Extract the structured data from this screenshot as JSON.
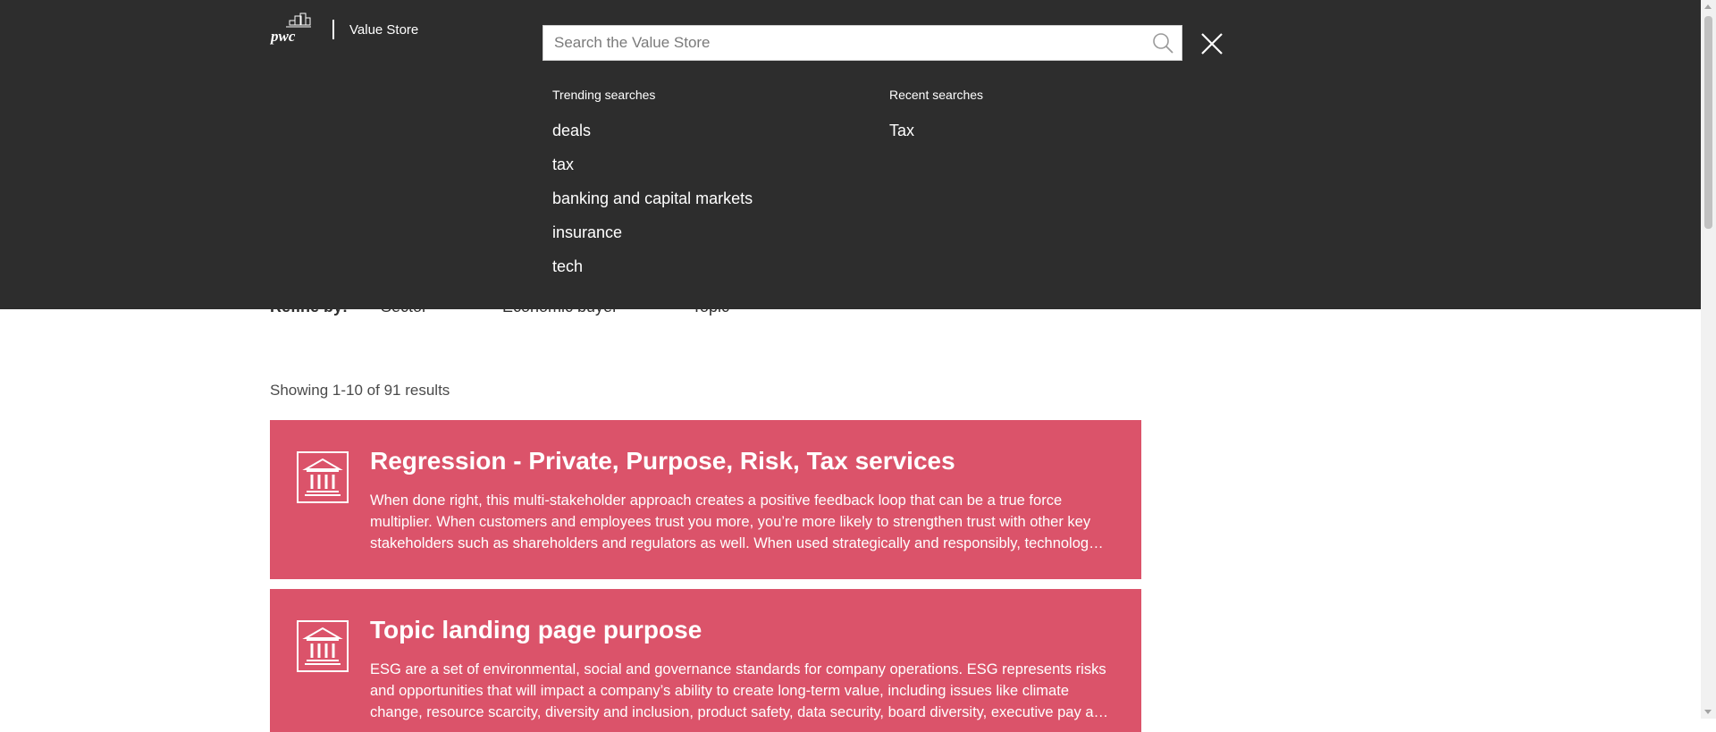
{
  "header": {
    "brand_name": "Value Store",
    "logo_text": "pwc",
    "search_placeholder": "Search the Value Store"
  },
  "trending": {
    "heading": "Trending searches",
    "items": [
      "deals",
      "tax",
      "banking and capital markets",
      "insurance",
      "tech"
    ]
  },
  "recent": {
    "heading": "Recent searches",
    "items": [
      "Tax"
    ]
  },
  "refine": {
    "label": "Refine by:",
    "options": [
      "Sector",
      "Economic buyer",
      "Topic"
    ]
  },
  "results": {
    "count_text": "Showing 1-10 of 91 results",
    "cards": [
      {
        "title": "Regression - Private, Purpose, Risk, Tax services",
        "description": "When done right, this multi-stakeholder approach creates a positive feedback loop that can be a true force multiplier. When customers and employees trust you more, you’re more likely to strengthen trust with other key stakeholders such as shareholders and regulators as well. When used strategically and responsibly, technology can also be a powerful enabler of trust.",
        "icon": "institution-icon"
      },
      {
        "title": "Topic landing page purpose",
        "description": "ESG are a set of environmental, social and governance standards for company operations. ESG represents risks and opportunities that will impact a company’s ability to create long-term value, including issues like climate change, resource scarcity, diversity and inclusion, product safety, data security, board diversity, executive pay and more.",
        "icon": "institution-icon"
      }
    ]
  },
  "colors": {
    "overlay_bg": "#2d2d2d",
    "card_bg": "#db536a",
    "text_white": "#ffffff"
  }
}
